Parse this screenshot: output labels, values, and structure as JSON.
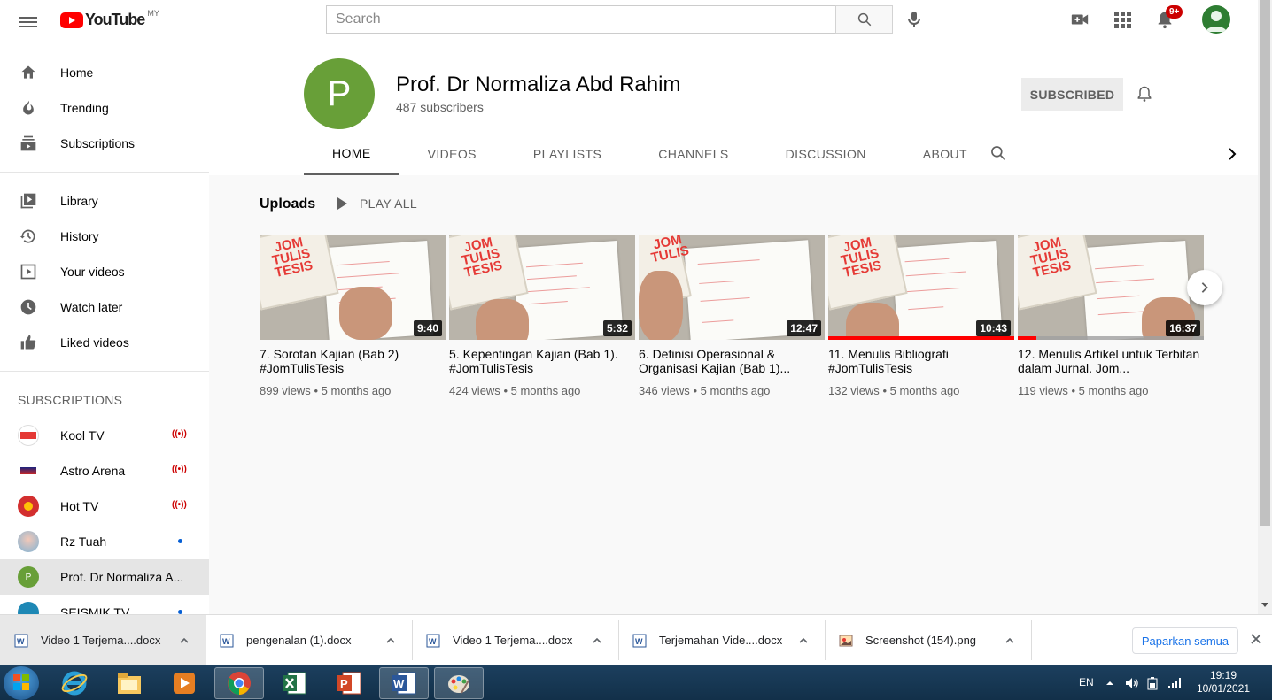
{
  "masthead": {
    "logo_text": "YouTube",
    "country_code": "MY",
    "search_placeholder": "Search",
    "notification_badge": "9+"
  },
  "sidebar": {
    "primary": [
      {
        "label": "Home",
        "icon": "home-icon"
      },
      {
        "label": "Trending",
        "icon": "trending-icon"
      },
      {
        "label": "Subscriptions",
        "icon": "subscriptions-icon"
      }
    ],
    "secondary": [
      {
        "label": "Library",
        "icon": "library-icon"
      },
      {
        "label": "History",
        "icon": "history-icon"
      },
      {
        "label": "Your videos",
        "icon": "your-videos-icon"
      },
      {
        "label": "Watch later",
        "icon": "watch-later-icon"
      },
      {
        "label": "Liked videos",
        "icon": "liked-icon"
      }
    ],
    "subscriptions_heading": "SUBSCRIPTIONS",
    "subscriptions": [
      {
        "label": "Kool TV",
        "indicator": "live"
      },
      {
        "label": "Astro Arena",
        "indicator": "live"
      },
      {
        "label": "Hot TV",
        "indicator": "live"
      },
      {
        "label": "Rz Tuah",
        "indicator": "new"
      },
      {
        "label": "Prof. Dr Normaliza A...",
        "indicator": "none",
        "active": true,
        "avatar_letter": "P"
      },
      {
        "label": "SEISMIK TV",
        "indicator": "new"
      }
    ]
  },
  "channel": {
    "avatar_letter": "P",
    "name": "Prof. Dr Normaliza Abd Rahim",
    "subscribers": "487 subscribers",
    "subscribe_label": "SUBSCRIBED",
    "tabs": [
      "HOME",
      "VIDEOS",
      "PLAYLISTS",
      "CHANNELS",
      "DISCUSSION",
      "ABOUT"
    ],
    "active_tab": "HOME"
  },
  "uploads": {
    "heading": "Uploads",
    "play_all": "PLAY ALL",
    "videos": [
      {
        "title": "7. Sorotan Kajian (Bab 2) #JomTulisTesis",
        "duration": "9:40",
        "views": "899 views",
        "age": "5 months ago",
        "watched": 0
      },
      {
        "title": "5. Kepentingan Kajian (Bab 1). #JomTulisTesis",
        "duration": "5:32",
        "views": "424 views",
        "age": "5 months ago",
        "watched": 0
      },
      {
        "title": "6. Definisi Operasional & Organisasi Kajian (Bab 1)...",
        "duration": "12:47",
        "views": "346 views",
        "age": "5 months ago",
        "watched": 0
      },
      {
        "title": "11. Menulis Bibliografi #JomTulisTesis",
        "duration": "10:43",
        "views": "132 views",
        "age": "5 months ago",
        "watched": 1.0
      },
      {
        "title": "12. Menulis Artikel untuk Terbitan dalam Jurnal. Jom...",
        "duration": "16:37",
        "views": "119 views",
        "age": "5 months ago",
        "watched": 0.1
      }
    ],
    "meta_separator": "•"
  },
  "downloads": {
    "items": [
      {
        "name": "Video 1 Terjema....docx",
        "type": "word"
      },
      {
        "name": "pengenalan (1).docx",
        "type": "word"
      },
      {
        "name": "Video 1 Terjema....docx",
        "type": "word"
      },
      {
        "name": "Terjemahan Vide....docx",
        "type": "word"
      },
      {
        "name": "Screenshot (154).png",
        "type": "image"
      }
    ],
    "show_all": "Paparkan semua"
  },
  "taskbar": {
    "language": "EN",
    "time": "19:19",
    "date": "10/01/2021",
    "apps": [
      "internet-explorer-icon",
      "file-explorer-icon",
      "media-player-icon",
      "chrome-icon",
      "excel-icon",
      "powerpoint-icon",
      "word-icon",
      "paint-icon"
    ],
    "active_app": "chrome-icon"
  },
  "colors": {
    "brand_red": "#ff0000",
    "channel_avatar": "#689f38",
    "link_blue": "#1a73e8"
  }
}
